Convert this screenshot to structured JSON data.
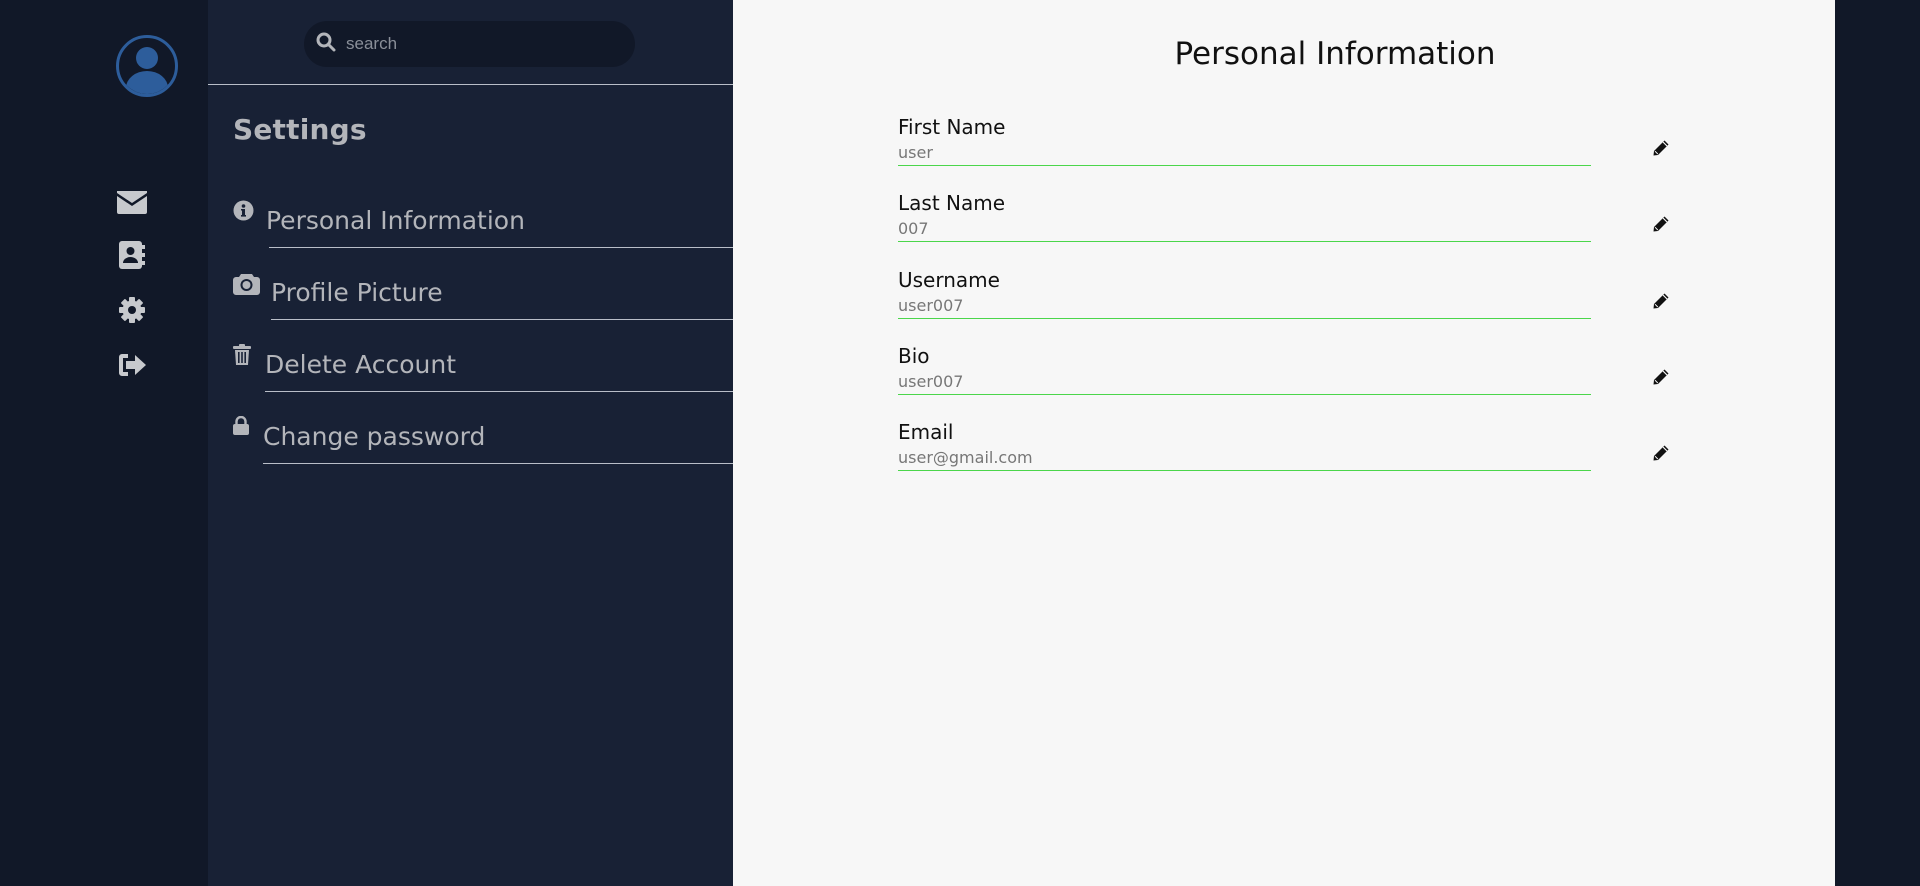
{
  "sidebar": {
    "search": {
      "placeholder": "search"
    },
    "title": "Settings",
    "items": [
      {
        "label": "Personal Information",
        "icon": "info-icon"
      },
      {
        "label": "Profile Picture",
        "icon": "camera-icon"
      },
      {
        "label": "Delete Account",
        "icon": "trash-icon"
      },
      {
        "label": "Change password",
        "icon": "lock-icon"
      }
    ]
  },
  "rail": {
    "icons": [
      "avatar-icon",
      "mail-icon",
      "contacts-icon",
      "gear-icon",
      "logout-icon"
    ]
  },
  "main": {
    "title": "Personal Information",
    "fields": [
      {
        "label": "First Name",
        "value": "user"
      },
      {
        "label": "Last Name",
        "value": "007"
      },
      {
        "label": "Username",
        "value": "user007"
      },
      {
        "label": "Bio",
        "value": "user007"
      },
      {
        "label": "Email",
        "value": "user@gmail.com"
      }
    ]
  },
  "colors": {
    "rail_bg": "#111828",
    "panel_bg": "#182135",
    "main_bg": "#f7f7f7",
    "accent_blue": "#2d5d9b",
    "field_underline": "#4bd64b",
    "muted_text": "#b3b5ba"
  }
}
